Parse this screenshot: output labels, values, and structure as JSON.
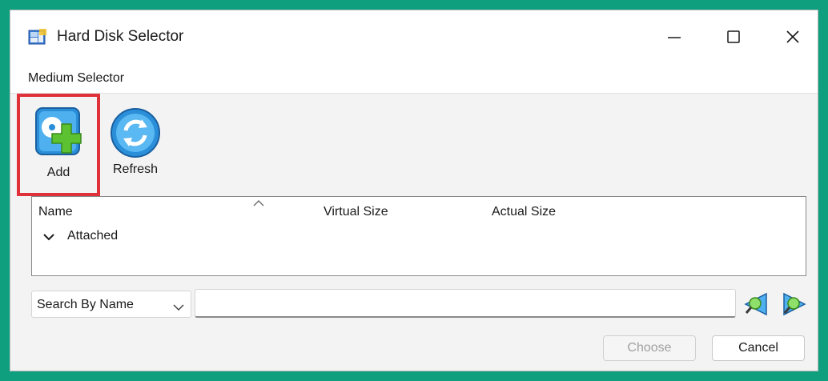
{
  "window": {
    "title": "Hard Disk Selector",
    "icon": "hard-disk-app-icon",
    "controls": [
      "minimize-icon",
      "maximize-icon",
      "close-icon"
    ]
  },
  "menu": {
    "items": [
      "Medium Selector"
    ]
  },
  "toolbar": {
    "add_label": "Add",
    "add_icon": "add-disk-icon",
    "refresh_label": "Refresh",
    "refresh_icon": "refresh-icon",
    "highlight_color": "#e0303a"
  },
  "tree": {
    "columns": [
      "Name",
      "Virtual Size",
      "Actual Size"
    ],
    "sort_indicator": "sort-ascending-icon",
    "groups": [
      {
        "label": "Attached",
        "expanded": true
      }
    ]
  },
  "search": {
    "mode": "Search By Name",
    "value": "",
    "prev_icon": "search-previous-icon",
    "next_icon": "search-next-icon"
  },
  "buttons": {
    "choose": "Choose",
    "cancel": "Cancel"
  },
  "colors": {
    "background": "#0f9f7f",
    "accent": "#2a8fd8",
    "add_green": "#5cc232"
  }
}
